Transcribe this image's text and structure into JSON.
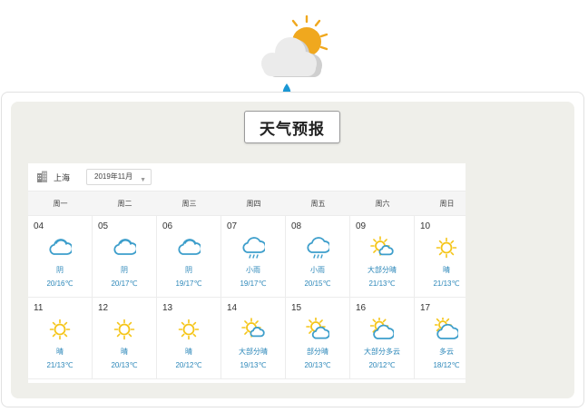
{
  "title": "天气预报",
  "city": "上海",
  "month": "2019年11月",
  "weekdays": [
    "周一",
    "周二",
    "周三",
    "周四",
    "周五",
    "周六",
    "周日"
  ],
  "days": [
    {
      "day": "04",
      "cond": "阴",
      "temp": "20/16℃",
      "icon": "overcast-icon"
    },
    {
      "day": "05",
      "cond": "阴",
      "temp": "20/17℃",
      "icon": "overcast-icon"
    },
    {
      "day": "06",
      "cond": "阴",
      "temp": "19/17℃",
      "icon": "overcast-icon"
    },
    {
      "day": "07",
      "cond": "小雨",
      "temp": "19/17℃",
      "icon": "light-rain-icon"
    },
    {
      "day": "08",
      "cond": "小雨",
      "temp": "20/15℃",
      "icon": "light-rain-icon"
    },
    {
      "day": "09",
      "cond": "大部分晴",
      "temp": "21/13℃",
      "icon": "mostly-sunny-icon"
    },
    {
      "day": "10",
      "cond": "晴",
      "temp": "21/13℃",
      "icon": "sunny-icon"
    },
    {
      "day": "11",
      "cond": "晴",
      "temp": "21/13℃",
      "icon": "sunny-icon"
    },
    {
      "day": "12",
      "cond": "晴",
      "temp": "20/13℃",
      "icon": "sunny-icon"
    },
    {
      "day": "13",
      "cond": "晴",
      "temp": "20/12℃",
      "icon": "sunny-icon"
    },
    {
      "day": "14",
      "cond": "大部分晴",
      "temp": "19/13℃",
      "icon": "mostly-sunny-icon"
    },
    {
      "day": "15",
      "cond": "部分晴",
      "temp": "20/13℃",
      "icon": "partly-sunny-icon"
    },
    {
      "day": "16",
      "cond": "大部分多云",
      "temp": "20/12℃",
      "icon": "mostly-cloudy-icon"
    },
    {
      "day": "17",
      "cond": "多云",
      "temp": "18/12℃",
      "icon": "cloudy-icon"
    }
  ],
  "colors": {
    "accent": "#2a86b8",
    "sun": "#f5c518",
    "sun_hero": "#f0a81e",
    "cloud_outline": "#3d9ecb",
    "rain_drop": "#1a97d4"
  }
}
